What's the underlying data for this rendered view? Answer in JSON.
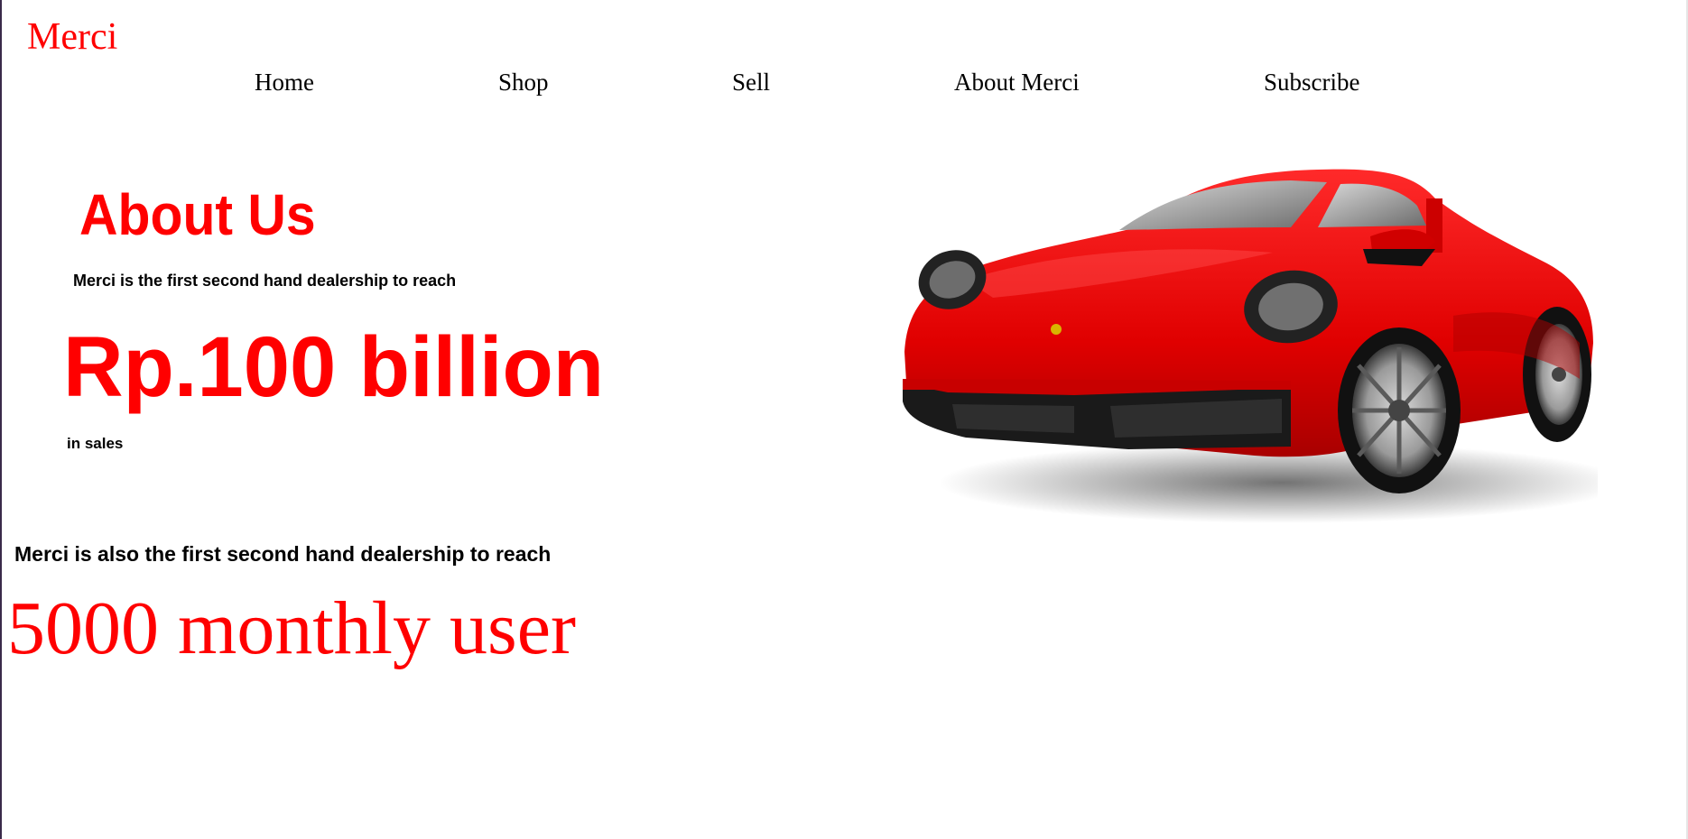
{
  "brand": {
    "name": "Merci"
  },
  "nav": {
    "items": [
      {
        "label": "Home"
      },
      {
        "label": "Shop"
      },
      {
        "label": "Sell"
      },
      {
        "label": "About Merci"
      },
      {
        "label": "Subscribe"
      }
    ]
  },
  "about": {
    "title": "About Us",
    "lead": "Merci is the first second hand dealership to reach",
    "highlight": "Rp.100 billion",
    "suffix": "in sales",
    "lead2": "Merci is also the first second hand dealership to reach",
    "highlight2": "5000 monthly user"
  },
  "colors": {
    "accent": "#ff0000",
    "text": "#000000",
    "background": "#ffffff"
  },
  "image": {
    "icon": "red-sports-car-image"
  }
}
